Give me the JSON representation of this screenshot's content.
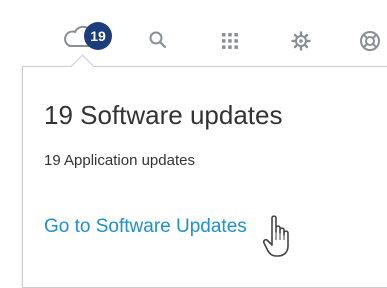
{
  "toolbar": {
    "notification_count": "19",
    "icons": [
      "cloud-icon",
      "search-icon",
      "apps-grid-icon",
      "gear-icon",
      "help-icon"
    ]
  },
  "popover": {
    "title": "19 Software updates",
    "subtitle": "19 Application updates",
    "link_label": "Go to Software Updates"
  },
  "colors": {
    "badge": "#1c3c7c",
    "link": "#1f8fd1",
    "text": "#333333",
    "icon": "#8a8f96"
  }
}
